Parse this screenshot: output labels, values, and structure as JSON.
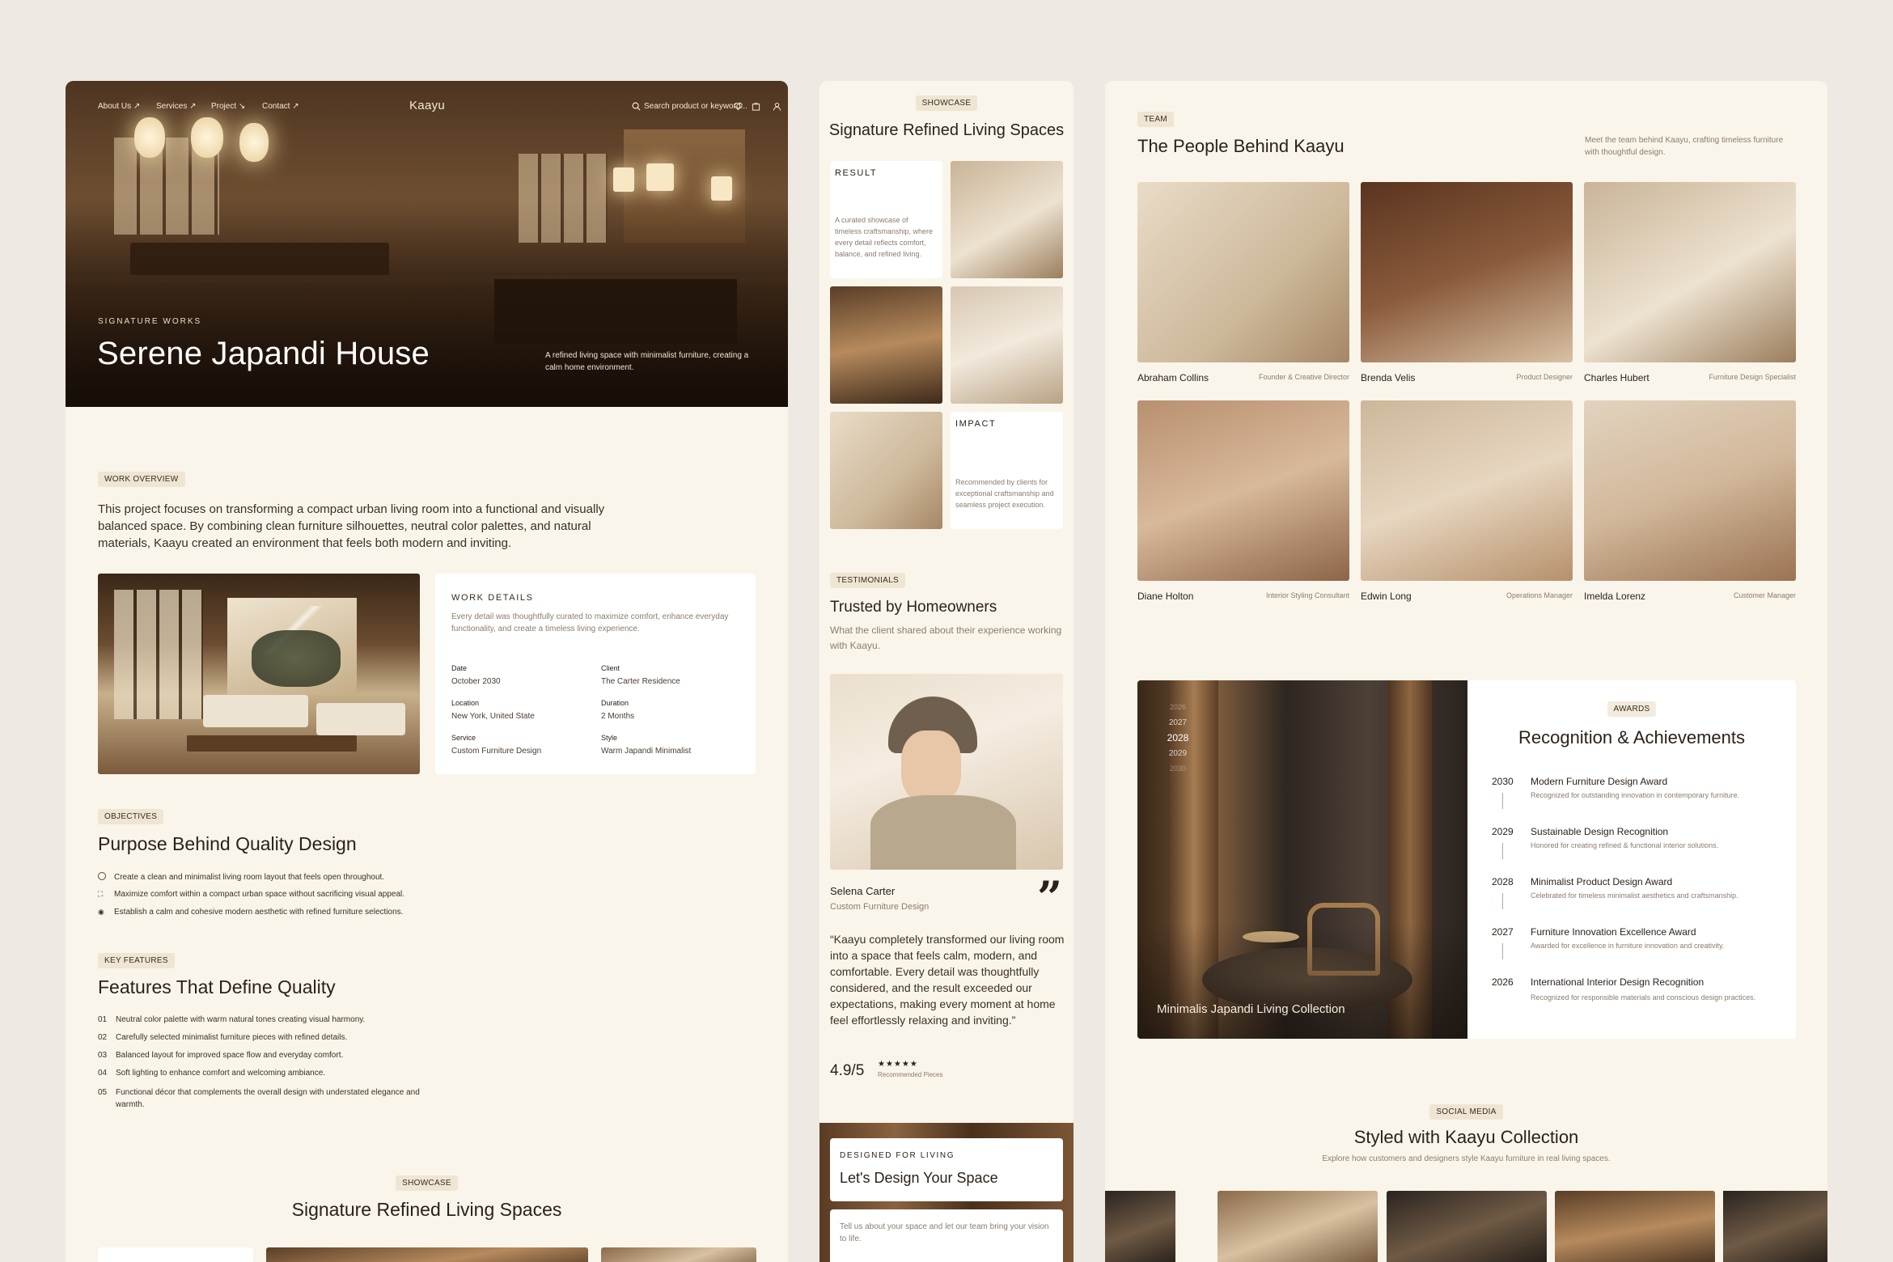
{
  "left": {
    "nav": {
      "items": [
        "About Us",
        "Services",
        "Project",
        "Contact"
      ],
      "logo": "Kaayu",
      "search_placeholder": "Search product or keyword..."
    },
    "hero": {
      "eyebrow": "SIGNATURE WORKS",
      "title": "Serene Japandi House",
      "caption": "A refined living space with minimalist furniture, creating a calm home environment."
    },
    "overview": {
      "chip": "WORK OVERVIEW",
      "text": "This project focuses on transforming a compact urban living room into a functional and visually balanced space. By combining clean furniture silhouettes, neutral color palettes, and natural materials, Kaayu created an environment that feels both modern and inviting."
    },
    "details": {
      "title": "WORK DETAILS",
      "desc": "Every detail was thoughtfully curated to maximize comfort, enhance everyday functionality, and create a timeless living experience.",
      "fields": [
        {
          "label": "Date",
          "value": "October 2030"
        },
        {
          "label": "Client",
          "value": "The Carter Residence"
        },
        {
          "label": "Location",
          "value": "New York, United State"
        },
        {
          "label": "Duration",
          "value": "2 Months"
        },
        {
          "label": "Service",
          "value": "Custom Furniture Design"
        },
        {
          "label": "Style",
          "value": "Warm Japandi Minimalist"
        }
      ]
    },
    "objectives": {
      "chip": "OBJECTIVES",
      "title": "Purpose Behind Quality Design",
      "items": [
        "Create a clean and minimalist living room layout that feels open throughout.",
        "Maximize comfort within a compact urban space without sacrificing visual appeal.",
        "Establish a calm and cohesive modern aesthetic with refined furniture selections."
      ]
    },
    "features": {
      "chip": "KEY FEATURES",
      "title": "Features That Define Quality",
      "items": [
        {
          "num": "01",
          "text": "Neutral color palette with warm natural tones creating visual harmony."
        },
        {
          "num": "02",
          "text": "Carefully selected minimalist furniture pieces with refined details."
        },
        {
          "num": "03",
          "text": "Balanced layout for improved space flow and everyday comfort."
        },
        {
          "num": "04",
          "text": "Soft lighting to enhance comfort and welcoming ambiance."
        },
        {
          "num": "05",
          "text": "Functional décor that complements the overall design with understated elegance and warmth."
        }
      ]
    },
    "showcase": {
      "chip": "SHOWCASE",
      "title": "Signature Refined Living Spaces"
    }
  },
  "middle": {
    "showcase": {
      "chip": "SHOWCASE",
      "title": "Signature Refined Living Spaces",
      "result_title": "RESULT",
      "result_text": "A curated showcase of timeless craftsmanship, where every detail reflects comfort, balance, and refined living.",
      "impact_title": "IMPACT",
      "impact_text": "Recommended by clients for exceptional craftsmanship and seamless project execution."
    },
    "testimonials": {
      "chip": "TESTIMONIALS",
      "title": "Trusted by Homeowners",
      "subtitle": "What the client shared about their experience working with Kaayu.",
      "name": "Selena Carter",
      "role": "Custom Furniture Design",
      "quote": "“Kaayu completely transformed our living room into a space that feels calm, modern, and comfortable. Every detail was thoughtfully considered, and the result exceeded our expectations, making every moment at home feel effortlessly relaxing and inviting.”",
      "rating": "4.9/5",
      "stars": "★★★★★",
      "rating_label": "Recommended Pieces"
    },
    "cta": {
      "eyebrow": "DESIGNED FOR LIVING",
      "title": "Let's Design Your Space",
      "text": "Tell us about your space and let our team bring your vision to life."
    }
  },
  "right": {
    "team": {
      "chip": "TEAM",
      "title": "The People Behind Kaayu",
      "subtitle": "Meet the team behind Kaayu, crafting timeless furniture with thoughtful design.",
      "members": [
        {
          "name": "Abraham Collins",
          "role": "Founder & Creative Director"
        },
        {
          "name": "Brenda Velis",
          "role": "Product Designer"
        },
        {
          "name": "Charles Hubert",
          "role": "Furniture Design Specialist"
        },
        {
          "name": "Diane Holton",
          "role": "Interior Styling Consultant"
        },
        {
          "name": "Edwin Long",
          "role": "Operations Manager"
        },
        {
          "name": "Imelda Lorenz",
          "role": "Customer Manager"
        }
      ]
    },
    "awards": {
      "image_caption": "Minimalis Japandi Living Collection",
      "years_side": [
        "2026",
        "2027",
        "2028",
        "2029",
        "2030"
      ],
      "chip": "AWARDS",
      "title": "Recognition & Achievements",
      "items": [
        {
          "year": "2030",
          "title": "Modern Furniture Design Award",
          "desc": "Recognized for outstanding innovation in contemporary furniture."
        },
        {
          "year": "2029",
          "title": "Sustainable Design Recognition",
          "desc": "Honored for creating refined & functional interior solutions."
        },
        {
          "year": "2028",
          "title": "Minimalist Product Design Award",
          "desc": "Celebrated for timeless minimalist aesthetics and craftsmanship."
        },
        {
          "year": "2027",
          "title": "Furniture Innovation Excellence Award",
          "desc": "Awarded for excellence in furniture innovation and creativity."
        },
        {
          "year": "2026",
          "title": "International Interior Design Recognition",
          "desc": "Recognized for responsible materials and conscious design practices."
        }
      ]
    },
    "social": {
      "chip": "SOCIAL MEDIA",
      "title": "Styled with Kaayu Collection",
      "subtitle": "Explore how customers and designers style Kaayu furniture in real living spaces."
    }
  }
}
